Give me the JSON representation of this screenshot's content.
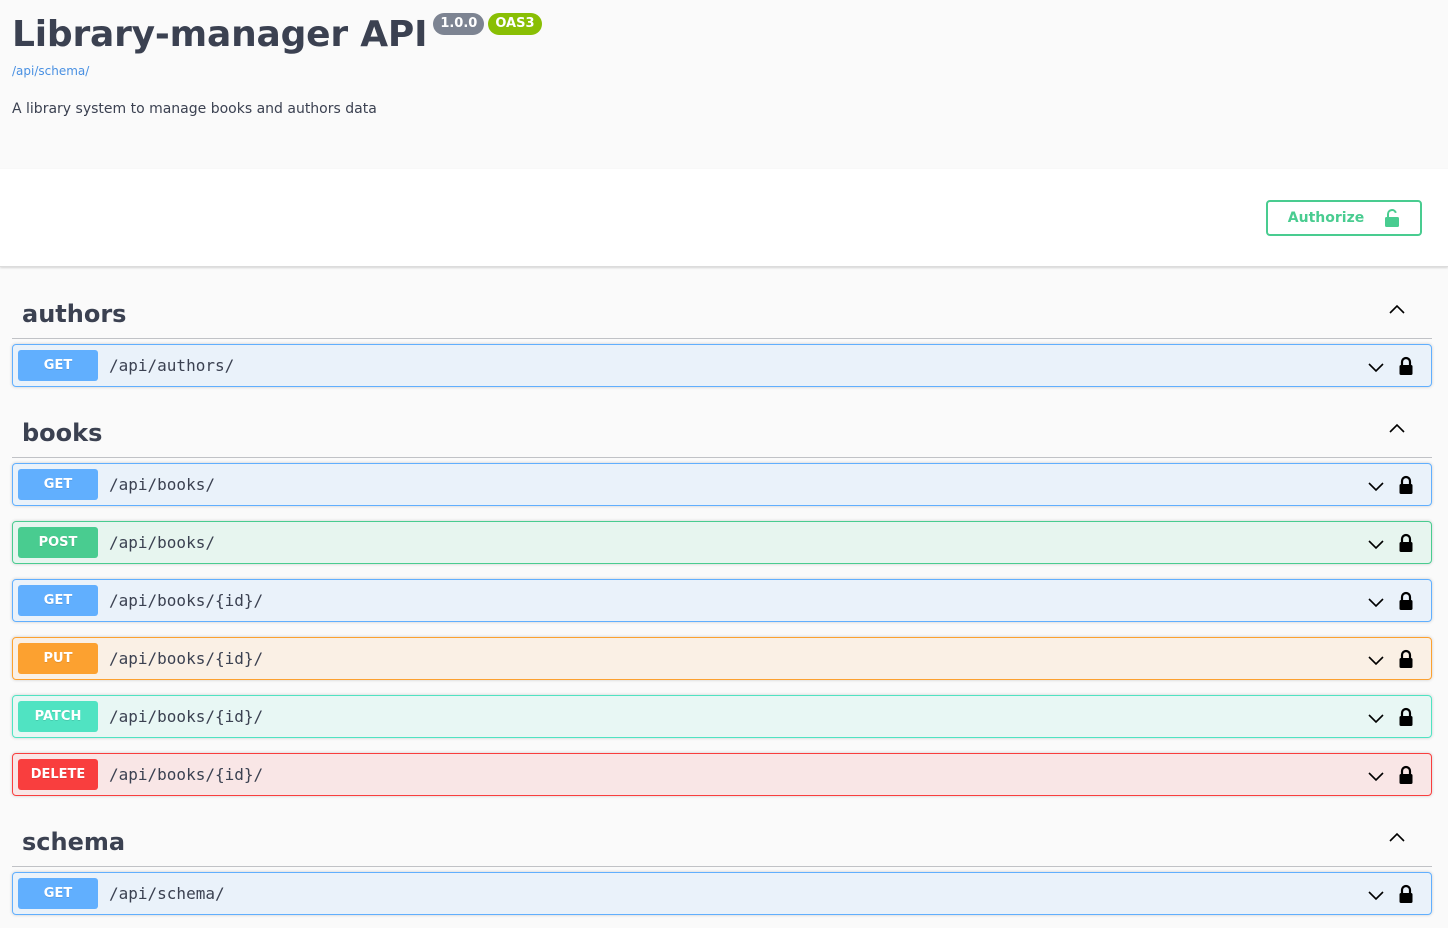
{
  "info": {
    "title": "Library-manager API",
    "version": "1.0.0",
    "oas_badge": "OAS3",
    "schema_url": "/api/schema/",
    "description": "A library system to manage books and authors data"
  },
  "authorize": {
    "label": "Authorize",
    "icon": "unlocked-padlock-icon",
    "color": "#49cc90"
  },
  "tags": [
    {
      "name": "authors",
      "operations": [
        {
          "method": "GET",
          "path": "/api/authors/"
        }
      ]
    },
    {
      "name": "books",
      "operations": [
        {
          "method": "GET",
          "path": "/api/books/"
        },
        {
          "method": "POST",
          "path": "/api/books/"
        },
        {
          "method": "GET",
          "path": "/api/books/{id}/"
        },
        {
          "method": "PUT",
          "path": "/api/books/{id}/"
        },
        {
          "method": "PATCH",
          "path": "/api/books/{id}/"
        },
        {
          "method": "DELETE",
          "path": "/api/books/{id}/"
        }
      ]
    },
    {
      "name": "schema",
      "operations": [
        {
          "method": "GET",
          "path": "/api/schema/"
        }
      ]
    }
  ],
  "method_colors": {
    "GET": "#61affe",
    "POST": "#49cc90",
    "PUT": "#fca130",
    "PATCH": "#50e3c2",
    "DELETE": "#f93e3e"
  }
}
